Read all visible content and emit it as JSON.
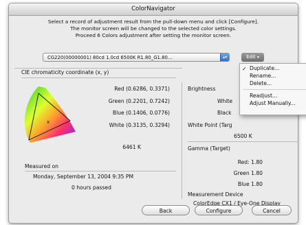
{
  "window": {
    "title": "ColorNavigator"
  },
  "instructions": {
    "line1": "Select a record of adjustment result from the pull-down menu and click [Configure].",
    "line2": "The monitor screen will be changed to the selected color settings.",
    "line3": "Proceed 6 Colors adjustment after setting the monitor screen."
  },
  "record_select": {
    "value": "CG220(00000001) 80cd 1.0cd 6500K R1.80_G1.80..."
  },
  "edit_button": {
    "label": "Edit"
  },
  "edit_menu": {
    "items": [
      "Duplicate...",
      "Rename...",
      "Delete...",
      "Readjust...",
      "Adjust Manually..."
    ],
    "checked": "Duplicate..."
  },
  "cie": {
    "title": "CIE chromaticity coordinate (x, y)",
    "red": "Red (0.6286, 0.3371)",
    "green": "Green (0.2201, 0.7242)",
    "blue": "Blue (0.1406, 0.0776)",
    "white": "White (0.3135, 0.3294)",
    "temp": "6461 K"
  },
  "brightness": {
    "title": "Brightness",
    "white_label": "White",
    "black_label": "Black"
  },
  "white_point": {
    "title": "White Point (Targ",
    "value": "6500 K"
  },
  "gamma": {
    "title": "Gamma (Target)",
    "red": "Red: 1.80",
    "green": "Green 1.80",
    "blue": "Blue 1.80"
  },
  "measured": {
    "title": "Measured on",
    "date": "Monday, September 13, 2004 9:35 PM",
    "passed": "0 hours passed"
  },
  "device": {
    "title": "Measurement Device",
    "value": "ColorEdge CX1 / Eye-One Display"
  },
  "buttons": {
    "back": "Back",
    "configure": "Configure",
    "cancel": "Cancel"
  }
}
